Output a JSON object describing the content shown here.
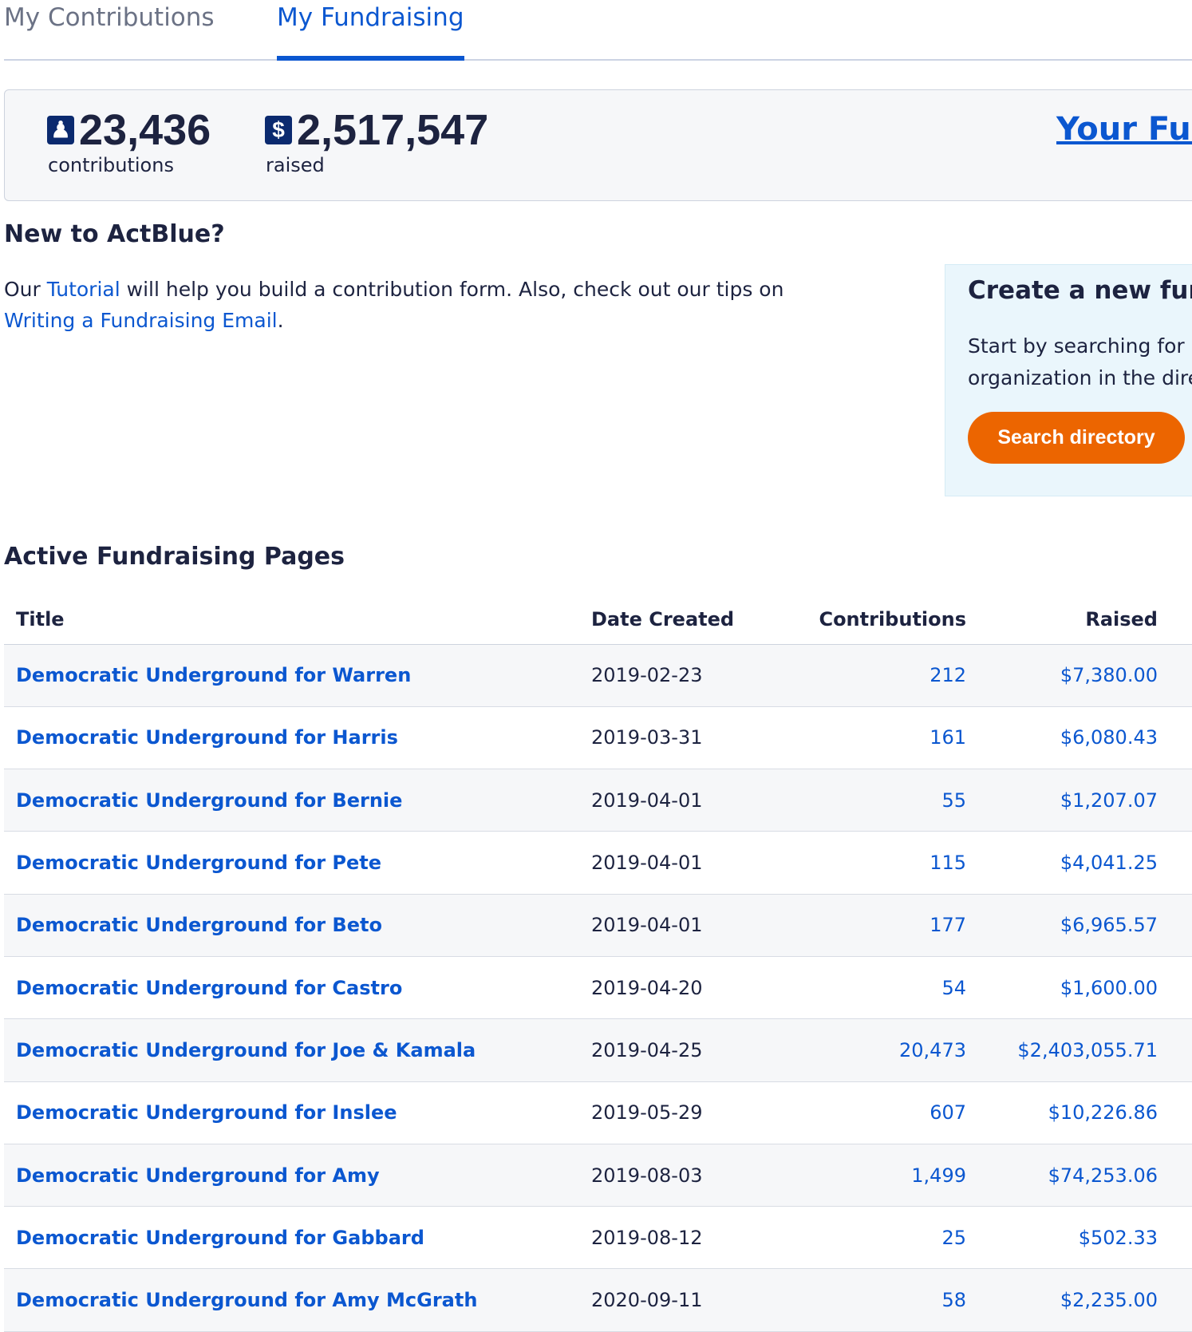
{
  "tabs": [
    {
      "label": "My Contributions",
      "active": false
    },
    {
      "label": "My Fundraising",
      "active": true
    }
  ],
  "summary": {
    "contributions_value": "23,436",
    "contributions_label": "contributions",
    "raised_value": "2,517,547",
    "raised_label": "raised",
    "link": "Your Fun",
    "contributions_icon": "person-icon",
    "raised_icon": "dollar-icon"
  },
  "intro": {
    "heading": "New to ActBlue?",
    "text_1": "Our ",
    "link_1": "Tutorial",
    "text_2": " will help you build a contribution form. Also, check out our tips on ",
    "link_2": "Writing a Fundraising Email",
    "text_3": "."
  },
  "panel": {
    "heading": "Create a new fund",
    "text_line1": "Start by searching for a c",
    "text_line2": "organization in the direc",
    "button": "Search directory"
  },
  "colors": {
    "accent": "#0b57d0",
    "button": "#ec6500",
    "text": "#1d2340"
  },
  "table": {
    "heading": "Active Fundraising Pages",
    "columns": [
      "Title",
      "Date Created",
      "Contributions",
      "Raised"
    ],
    "rows": [
      {
        "title": "Democratic Underground for Warren",
        "date": "2019-02-23",
        "contributions": "212",
        "raised": "$7,380.00"
      },
      {
        "title": "Democratic Underground for Harris",
        "date": "2019-03-31",
        "contributions": "161",
        "raised": "$6,080.43"
      },
      {
        "title": "Democratic Underground for Bernie",
        "date": "2019-04-01",
        "contributions": "55",
        "raised": "$1,207.07"
      },
      {
        "title": "Democratic Underground for Pete",
        "date": "2019-04-01",
        "contributions": "115",
        "raised": "$4,041.25"
      },
      {
        "title": "Democratic Underground for Beto",
        "date": "2019-04-01",
        "contributions": "177",
        "raised": "$6,965.57"
      },
      {
        "title": "Democratic Underground for Castro",
        "date": "2019-04-20",
        "contributions": "54",
        "raised": "$1,600.00"
      },
      {
        "title": "Democratic Underground for Joe & Kamala",
        "date": "2019-04-25",
        "contributions": "20,473",
        "raised": "$2,403,055.71"
      },
      {
        "title": "Democratic Underground for Inslee",
        "date": "2019-05-29",
        "contributions": "607",
        "raised": "$10,226.86"
      },
      {
        "title": "Democratic Underground for Amy",
        "date": "2019-08-03",
        "contributions": "1,499",
        "raised": "$74,253.06"
      },
      {
        "title": "Democratic Underground for Gabbard",
        "date": "2019-08-12",
        "contributions": "25",
        "raised": "$502.33"
      },
      {
        "title": "Democratic Underground for Amy McGrath",
        "date": "2020-09-11",
        "contributions": "58",
        "raised": "$2,235.00"
      }
    ]
  }
}
